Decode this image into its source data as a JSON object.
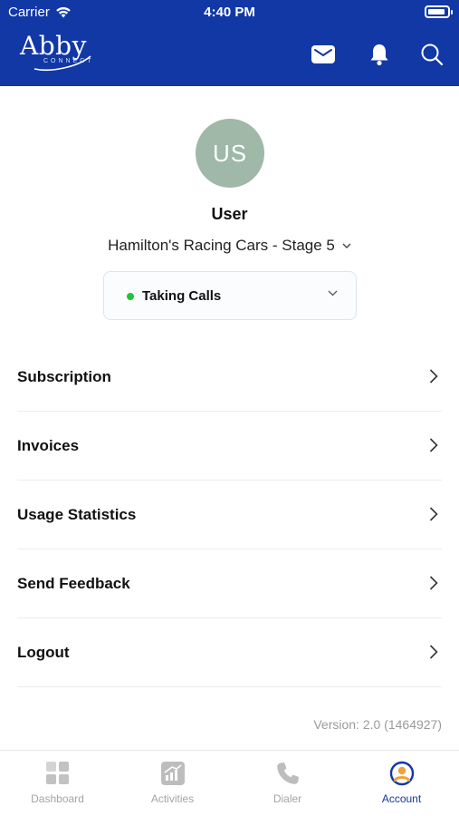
{
  "status_bar": {
    "carrier": "Carrier",
    "time": "4:40 PM"
  },
  "app_bar": {
    "logo_text": "Abby",
    "logo_subtext": "CONNECT",
    "icons": [
      "mail-icon",
      "bell-icon",
      "search-icon"
    ],
    "background_color": "#1238a6"
  },
  "profile": {
    "initials": "US",
    "name": "User",
    "company": "Hamilton's Racing Cars - Stage 5",
    "avatar_color": "#9fb8a8"
  },
  "call_status": {
    "label": "Taking Calls",
    "indicator_color": "#22c23a"
  },
  "menu": {
    "items": [
      {
        "label": "Subscription"
      },
      {
        "label": "Invoices"
      },
      {
        "label": "Usage Statistics"
      },
      {
        "label": "Send Feedback"
      },
      {
        "label": "Logout"
      }
    ]
  },
  "version": "Version: 2.0 (1464927)",
  "tabs": [
    {
      "label": "Dashboard",
      "icon": "dashboard-icon"
    },
    {
      "label": "Activities",
      "icon": "activities-icon"
    },
    {
      "label": "Dialer",
      "icon": "phone-icon"
    },
    {
      "label": "Account",
      "icon": "account-icon",
      "active": true
    }
  ]
}
